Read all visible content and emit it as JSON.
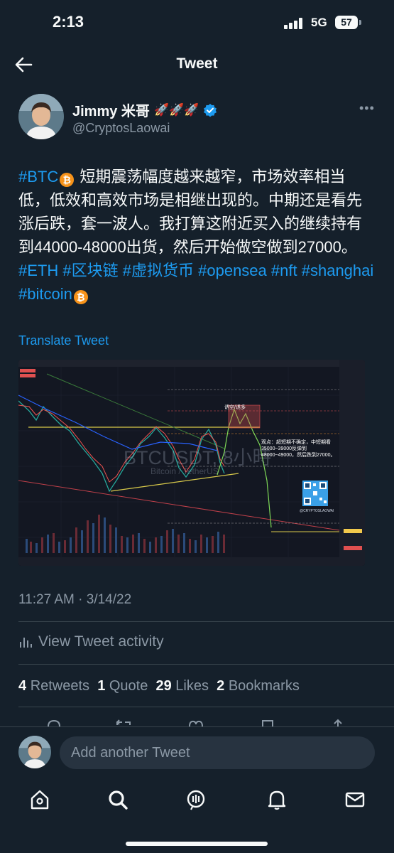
{
  "status_bar": {
    "time": "2:13",
    "network": "5G",
    "battery": "57"
  },
  "header": {
    "title": "Tweet"
  },
  "author": {
    "name": "Jimmy 米哥",
    "emojis": "🚀🚀🚀",
    "handle": "@CryptosLaowai"
  },
  "tweet": {
    "segments": [
      {
        "text": "#BTC",
        "tag": true
      },
      {
        "text": " ",
        "coin": true
      },
      {
        "text": " 短期震荡幅度越来越窄，市场效率相当低，低效和高效市场是相继出现的。中期还是看先涨后跌，套一波人。我打算这附近买入的继续持有到44000-48000出货，然后开始做空做到27000。 "
      },
      {
        "text": "#ETH",
        "tag": true
      },
      {
        "text": " "
      },
      {
        "text": "#区块链",
        "tag": true
      },
      {
        "text": " "
      },
      {
        "text": "#虚拟货币",
        "tag": true
      },
      {
        "text": " "
      },
      {
        "text": "#opensea",
        "tag": true
      },
      {
        "text": " "
      },
      {
        "text": "#nft",
        "tag": true
      },
      {
        "text": " "
      },
      {
        "text": "#shanghai",
        "tag": true
      },
      {
        "text": " "
      },
      {
        "text": "#bitcoin",
        "tag": true
      },
      {
        "text": " ",
        "coin": true
      }
    ],
    "coin_symbol": "₿",
    "translate_label": "Translate Tweet",
    "timestamp": "11:27 AM · 3/14/22",
    "activity_label": "View Tweet activity"
  },
  "chart_image": {
    "watermark": "BTCUSDT, 8小時",
    "watermark_sub": "Bitcoin / TetherUS",
    "tag_label": "诱空/诱多",
    "note": "观点：超短期不确定，中短期看35000~39000反弹到48000~49000，然后跌到27000。",
    "qr_caption": "@CRYPTOSLAOWAI"
  },
  "stats": {
    "retweets_count": "4",
    "retweets_label": "Retweets",
    "quotes_count": "1",
    "quotes_label": "Quote",
    "likes_count": "29",
    "likes_label": "Likes",
    "bookmarks_count": "2",
    "bookmarks_label": "Bookmarks"
  },
  "reply": {
    "placeholder": "Add another Tweet"
  },
  "colors": {
    "accent": "#1d9bf0",
    "background": "#15202b",
    "muted": "#8b98a5",
    "bitcoin": "#f7931a"
  },
  "icons": {
    "nav": [
      "home-icon",
      "search-icon",
      "spaces-icon",
      "notifications-icon",
      "messages-icon"
    ],
    "actions": [
      "reply-icon",
      "retweet-icon",
      "like-icon",
      "bookmark-icon",
      "share-icon"
    ]
  }
}
